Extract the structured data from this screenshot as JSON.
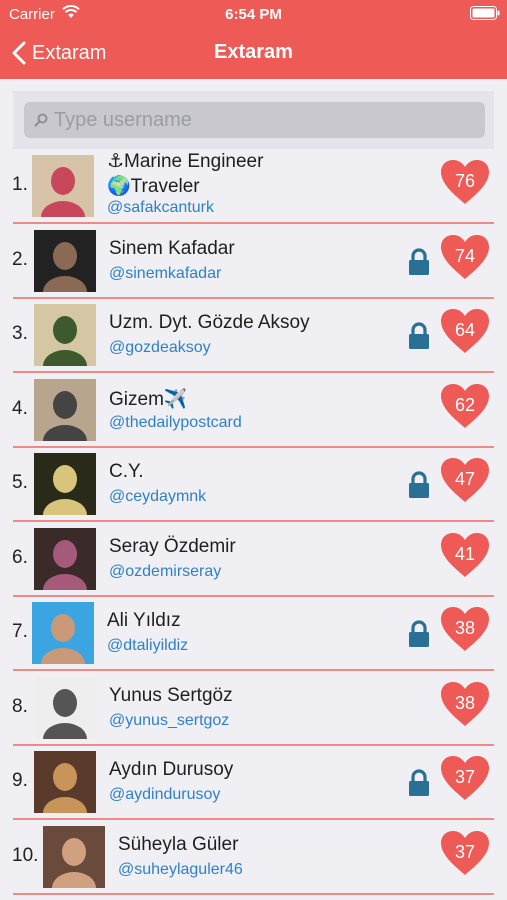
{
  "status_bar": {
    "carrier": "Carrier",
    "time": "6:54 PM"
  },
  "nav": {
    "back_label": "Extaram",
    "title": "Extaram"
  },
  "search": {
    "placeholder": "Type username"
  },
  "colors": {
    "accent": "#ee5a56",
    "link": "#2f80c8",
    "lock": "#2a6f94",
    "separator": "#ee8a87"
  },
  "rows": [
    {
      "rank": "1.",
      "name": "⚓Marine Engineer",
      "name2": "🌍Traveler",
      "handle": "@safakcanturk",
      "locked": false,
      "score": "76"
    },
    {
      "rank": "2.",
      "name": "Sinem Kafadar",
      "handle": "@sinemkafadar",
      "locked": true,
      "score": "74"
    },
    {
      "rank": "3.",
      "name": "Uzm. Dyt. Gözde Aksoy",
      "handle": "@gozdeaksoy",
      "locked": true,
      "score": "64"
    },
    {
      "rank": "4.",
      "name": "Gizem✈️",
      "handle": "@thedailypostcard",
      "locked": false,
      "score": "62"
    },
    {
      "rank": "5.",
      "name": "C.Y.",
      "handle": "@ceydaymnk",
      "locked": true,
      "score": "47"
    },
    {
      "rank": "6.",
      "name": "Seray Özdemir",
      "handle": "@ozdemirseray",
      "locked": false,
      "score": "41"
    },
    {
      "rank": "7.",
      "name": "Ali Yıldız",
      "handle": "@dtaliyildiz",
      "locked": true,
      "score": "38"
    },
    {
      "rank": "8.",
      "name": "Yunus Sertgöz",
      "handle": "@yunus_sertgoz",
      "locked": false,
      "score": "38"
    },
    {
      "rank": "9.",
      "name": "Aydın Durusoy",
      "handle": "@aydindurusoy",
      "locked": true,
      "score": "37"
    },
    {
      "rank": "10.",
      "name": "Süheyla Güler",
      "handle": "@suheylaguler46",
      "locked": false,
      "score": "37"
    }
  ]
}
